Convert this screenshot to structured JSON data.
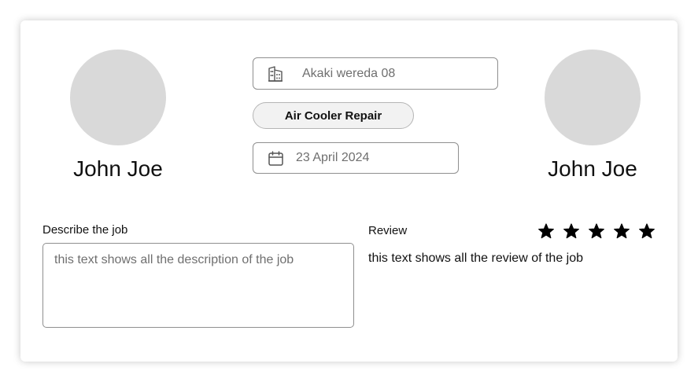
{
  "left_profile": {
    "name": "John Joe"
  },
  "right_profile": {
    "name": "John Joe"
  },
  "location": {
    "value": "Akaki wereda 08",
    "icon": "building-icon"
  },
  "service": {
    "label": "Air Cooler Repair"
  },
  "date": {
    "value": "23 April 2024",
    "icon": "calendar-icon"
  },
  "description": {
    "label": "Describe the job",
    "value": "this text shows all the description of the job"
  },
  "review": {
    "label": "Review",
    "rating": 5,
    "max_rating": 5,
    "text": "this text shows all the review of the job"
  },
  "colors": {
    "avatar": "#d9d9d9",
    "border": "#8f8f8f",
    "chip_bg": "#f2f2f2",
    "star": "#000000"
  }
}
